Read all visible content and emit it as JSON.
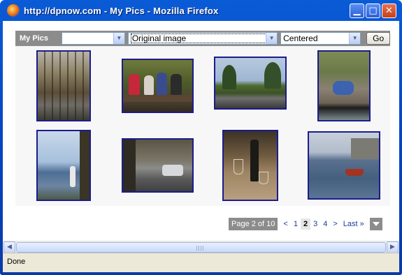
{
  "window": {
    "title": "http://dpnow.com - My Pics - Mozilla Firefox",
    "buttons": [
      "minimize",
      "maximize",
      "close"
    ]
  },
  "toolbar": {
    "label": "My Pics",
    "select1_value": "",
    "select2_value": "Original image",
    "select3_value": "Centered",
    "go_label": "Go"
  },
  "gallery": {
    "thumbnails": [
      {
        "subject": "woodland stream",
        "row": 1,
        "col": 1
      },
      {
        "subject": "group of people on a log",
        "row": 1,
        "col": 2
      },
      {
        "subject": "pond with trees",
        "row": 1,
        "col": 3
      },
      {
        "subject": "person in blue jacket on rocks",
        "row": 1,
        "col": 4
      },
      {
        "subject": "person by a lake",
        "row": 2,
        "col": 1
      },
      {
        "subject": "car on tree-lined road",
        "row": 2,
        "col": 2
      },
      {
        "subject": "wine bottle and glasses",
        "row": 2,
        "col": 3
      },
      {
        "subject": "boat in harbour",
        "row": 2,
        "col": 4
      }
    ],
    "frame_color": "#1c1c8c"
  },
  "pager": {
    "info": "Page 2 of 10",
    "prev": "<",
    "pages": [
      "1",
      "2",
      "3",
      "4"
    ],
    "current": "2",
    "next": ">",
    "last": "Last »"
  },
  "status": {
    "text": "Done"
  },
  "colors": {
    "titlebar": "#0645c4",
    "toolbar": "#8c8c8c",
    "link": "#1a3b9b"
  }
}
